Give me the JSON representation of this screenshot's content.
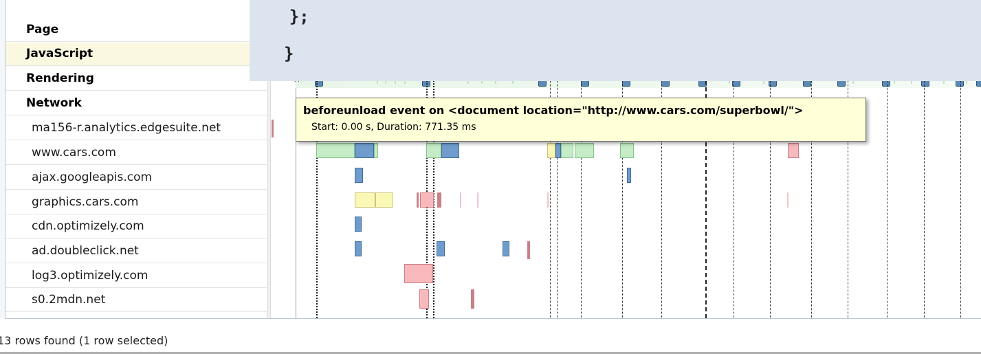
{
  "code_overlay": {
    "lines": [
      "    };",
      "}"
    ]
  },
  "categories": [
    {
      "label": "Page"
    },
    {
      "label": "JavaScript"
    },
    {
      "label": "Rendering"
    },
    {
      "label": "Network"
    }
  ],
  "hosts": [
    {
      "label": "ma156-r.analytics.edgesuite.net"
    },
    {
      "label": "www.cars.com"
    },
    {
      "label": "ajax.googleapis.com"
    },
    {
      "label": "graphics.cars.com"
    },
    {
      "label": "cdn.optimizely.com"
    },
    {
      "label": "ad.doubleclick.net"
    },
    {
      "label": "log3.optimizely.com"
    },
    {
      "label": "s0.2mdn.net"
    }
  ],
  "tooltip": {
    "title": "beforeunload event on <document location=\"http://www.cars.com/superbowl/\">",
    "detail": "Start: 0.00 s, Duration: 771.35 ms"
  },
  "status": {
    "text": "13 rows found (1 row selected)"
  },
  "colors": {
    "receive": "#6f9ccc",
    "connect": "#c5ecc6",
    "wait": "#fbf7b5",
    "blocked": "#f8b9bd",
    "tooltip_bg": "#ffffd8",
    "selected_row": "#fbf8e1"
  }
}
